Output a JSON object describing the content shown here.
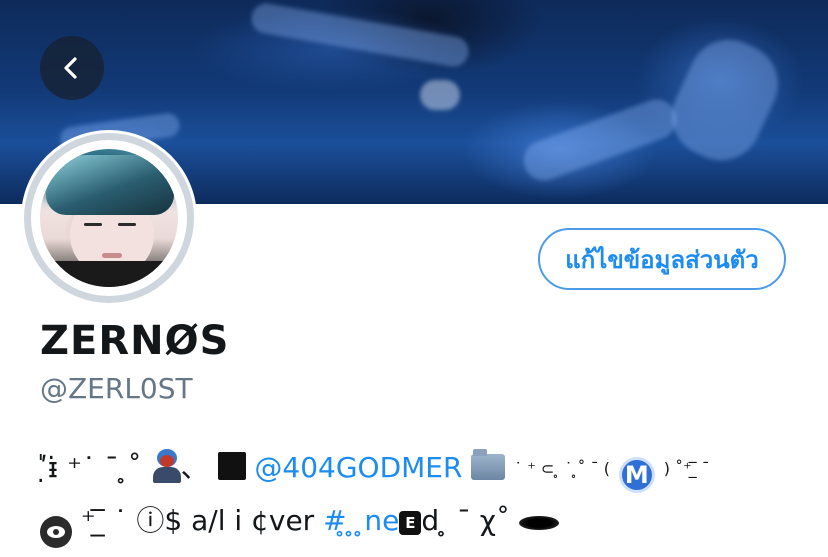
{
  "header": {
    "back_icon": "chevron-left-icon"
  },
  "profile": {
    "display_name": "ZERNØS",
    "handle": "@ZERL0ST",
    "edit_button_label": "แก้ไขข้อมูลส่วนตัว"
  },
  "bio": {
    "line1": {
      "seg1": "ʹ̣̍ᵻ̇ ⁺˙ ˉ ̥˚ ",
      "seg2": "、",
      "seg3": " ",
      "mention": "@404GODMER",
      "seg4": " ",
      "seg5": "˙ ⁺ ⊂ ̥ ˙ ̥˚ ˉ (",
      "badge": "M",
      "seg6": ") ˚⁺ ̲̅ ˉ"
    },
    "line2": {
      "seg1": " ",
      "seg2": "⁺ ̲̅ ˙ ⓘ$ a/l i ¢ver ",
      "hashtag": "#",
      "hashtag_rest": "̥ ̥ ̥ne",
      "ebox": "E",
      "seg3": "d ̥ ˉ χ˚ "
    },
    "icons": [
      "person-emoji-icon",
      "black-square-icon",
      "folder-icon",
      "eye-speech-icon",
      "hole-icon"
    ]
  },
  "colors": {
    "accent": "#1d8cf0",
    "secondary_text": "#657786",
    "primary_text": "#14171a"
  }
}
